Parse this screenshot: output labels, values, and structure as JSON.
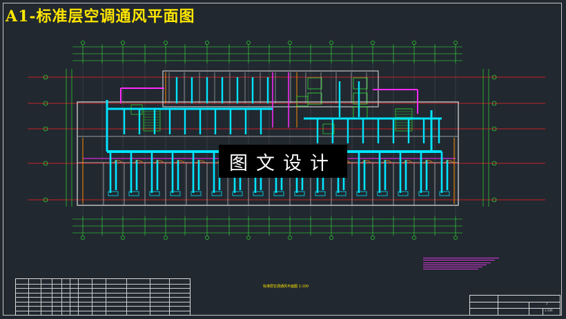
{
  "title": "A1-标准层空调通风平面图",
  "watermark": "图文设计",
  "caption": "标准层空调通风平面图   1:100",
  "titleblock": {
    "scale": "1:100",
    "sheet": "2"
  },
  "colors": {
    "background": "#212830",
    "title": "#ffe600",
    "duct": "#00e5ff",
    "exhaust": "#ff2bff",
    "wall": "#c8c8c8",
    "grid_red": "#ff2020",
    "dim_green": "#32ff32",
    "door": "#ff8c00"
  }
}
